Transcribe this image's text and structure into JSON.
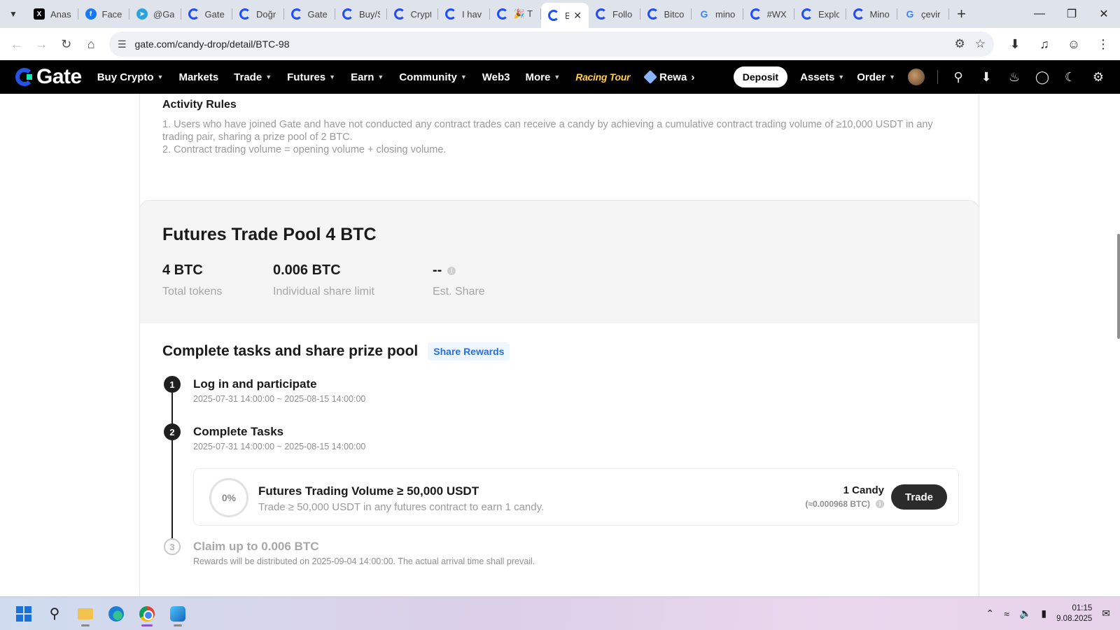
{
  "browser": {
    "tabs": [
      {
        "title": "Anas",
        "icon": "x-icon"
      },
      {
        "title": "Faceb",
        "icon": "facebook-icon"
      },
      {
        "title": "@Ga",
        "icon": "telegram-icon"
      },
      {
        "title": "Gate",
        "icon": "gate-icon"
      },
      {
        "title": "Doğr",
        "icon": "gate-icon"
      },
      {
        "title": "Gate",
        "icon": "gate-icon"
      },
      {
        "title": "Buy/S",
        "icon": "gate-icon"
      },
      {
        "title": "Crypt",
        "icon": "gate-icon"
      },
      {
        "title": "I hav",
        "icon": "gate-icon"
      },
      {
        "title": "🎉 T",
        "icon": "gate-icon"
      },
      {
        "title": "E",
        "icon": "gate-icon",
        "active": true
      },
      {
        "title": "Follo",
        "icon": "gate-icon"
      },
      {
        "title": "Bitco",
        "icon": "gate-icon"
      },
      {
        "title": "mino",
        "icon": "google-icon"
      },
      {
        "title": "#WX",
        "icon": "gate-icon"
      },
      {
        "title": "Explo",
        "icon": "gate-icon"
      },
      {
        "title": "Mino",
        "icon": "gate-icon"
      },
      {
        "title": "çevir",
        "icon": "google-icon"
      }
    ],
    "url": "gate.com/candy-drop/detail/BTC-98"
  },
  "header": {
    "logo": "Gate",
    "nav": [
      {
        "label": "Buy Crypto",
        "dropdown": true
      },
      {
        "label": "Markets",
        "dropdown": false
      },
      {
        "label": "Trade",
        "dropdown": true
      },
      {
        "label": "Futures",
        "dropdown": true
      },
      {
        "label": "Earn",
        "dropdown": true
      },
      {
        "label": "Community",
        "dropdown": true
      },
      {
        "label": "Web3",
        "dropdown": false
      },
      {
        "label": "More",
        "dropdown": true
      }
    ],
    "racing_label": "Racing Tour",
    "rewards_label": "Rewa",
    "deposit_label": "Deposit",
    "assets_label": "Assets",
    "order_label": "Order"
  },
  "rules": {
    "title": "Activity Rules",
    "line1": "1. Users who have joined Gate and have not conducted any contract trades can receive a candy by achieving a cumulative contract trading volume of ≥10,000 USDT in any trading pair, sharing a prize pool of 2 BTC.",
    "line2": "2. Contract trading volume = opening volume + closing volume."
  },
  "pool": {
    "title": "Futures Trade Pool 4 BTC",
    "stats": [
      {
        "value": "4 BTC",
        "label": "Total tokens"
      },
      {
        "value": "0.006 BTC",
        "label": "Individual share limit"
      },
      {
        "value": "--",
        "label": "Est. Share"
      }
    ]
  },
  "tasks": {
    "title": "Complete tasks and share prize pool",
    "share_label": "Share Rewards",
    "steps": [
      {
        "num": "1",
        "title": "Log in and participate",
        "sub": "2025-07-31 14:00:00 ~ 2025-08-15 14:00:00"
      },
      {
        "num": "2",
        "title": "Complete Tasks",
        "sub": "2025-07-31 14:00:00 ~ 2025-08-15 14:00:00"
      },
      {
        "num": "3",
        "title": "Claim up to 0.006 BTC",
        "sub": "Rewards will be distributed on 2025-09-04 14:00:00. The actual arrival time shall prevail."
      }
    ],
    "task": {
      "progress": "0%",
      "title": "Futures Trading Volume ≥ 50,000 USDT",
      "desc": "Trade ≥ 50,000 USDT in any futures contract to earn 1 candy.",
      "reward": "1 Candy",
      "reward_btc": "(≈0.000968 BTC)",
      "button": "Trade"
    }
  },
  "taskbar": {
    "time": "01:15",
    "date": "9.08.2025"
  }
}
